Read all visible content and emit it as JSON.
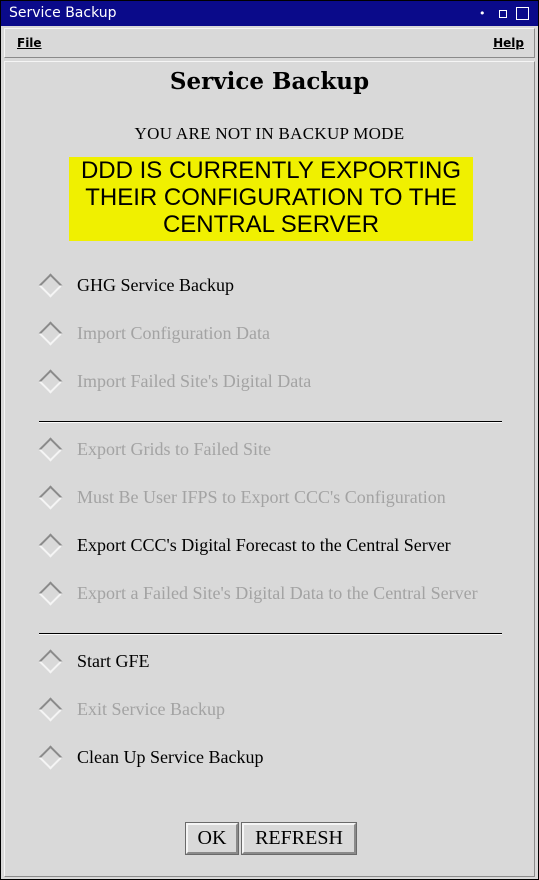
{
  "window": {
    "title": "Service Backup"
  },
  "menubar": {
    "file": "File",
    "help": "Help"
  },
  "dialog": {
    "heading": "Service Backup",
    "mode_status": "YOU ARE NOT IN BACKUP MODE",
    "banner_lines": [
      "DDD IS CURRENTLY EXPORTING",
      "THEIR CONFIGURATION TO THE",
      "CENTRAL SERVER"
    ],
    "banner_color": "#f0f000"
  },
  "options": [
    {
      "label": "GHG Service Backup",
      "enabled": true
    },
    {
      "label": "Import Configuration Data",
      "enabled": false
    },
    {
      "label": "Import Failed Site's Digital Data",
      "enabled": false
    },
    {
      "label": "Export Grids to Failed Site",
      "enabled": false
    },
    {
      "label": "Must Be User IFPS to Export CCC's Configuration",
      "enabled": false
    },
    {
      "label": "Export CCC's Digital Forecast to the Central Server",
      "enabled": true
    },
    {
      "label": "Export a Failed Site's Digital Data to the Central Server",
      "enabled": false
    },
    {
      "label": "Start GFE",
      "enabled": true
    },
    {
      "label": "Exit Service Backup",
      "enabled": false
    },
    {
      "label": "Clean Up Service Backup",
      "enabled": true
    }
  ],
  "buttons": {
    "ok": "OK",
    "refresh": "REFRESH"
  },
  "colors": {
    "titlebar": "#0a0a8a",
    "background": "#d9d9d9",
    "disabled_text": "#a3a3a3"
  }
}
